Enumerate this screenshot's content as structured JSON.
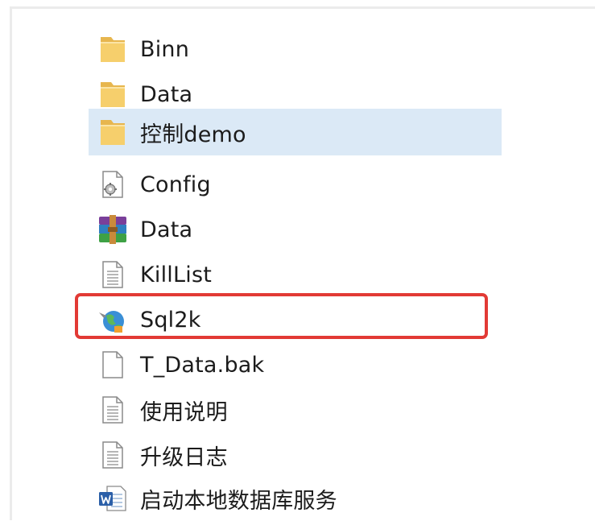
{
  "files": [
    {
      "name": "Binn",
      "icon": "folder-icon",
      "selected": false
    },
    {
      "name": "Data",
      "icon": "folder-icon",
      "selected": false
    },
    {
      "name": "控制demo",
      "icon": "folder-icon",
      "selected": true
    },
    {
      "name": "Config",
      "icon": "config-file-icon",
      "selected": false
    },
    {
      "name": "Data",
      "icon": "winrar-archive-icon",
      "selected": false
    },
    {
      "name": "KillList",
      "icon": "text-file-icon",
      "selected": false
    },
    {
      "name": "Sql2k",
      "icon": "globe-program-icon",
      "selected": false,
      "annotated": true
    },
    {
      "name": "T_Data.bak",
      "icon": "blank-file-icon",
      "selected": false
    },
    {
      "name": "使用说明",
      "icon": "text-file-icon",
      "selected": false
    },
    {
      "name": "升级日志",
      "icon": "text-file-icon",
      "selected": false
    },
    {
      "name": "启动本地数据库服务",
      "icon": "word-document-icon",
      "selected": false
    }
  ],
  "colors": {
    "selection": "#dbe9f6",
    "annotation_border": "#e23a35",
    "folder": "#f3c964"
  }
}
